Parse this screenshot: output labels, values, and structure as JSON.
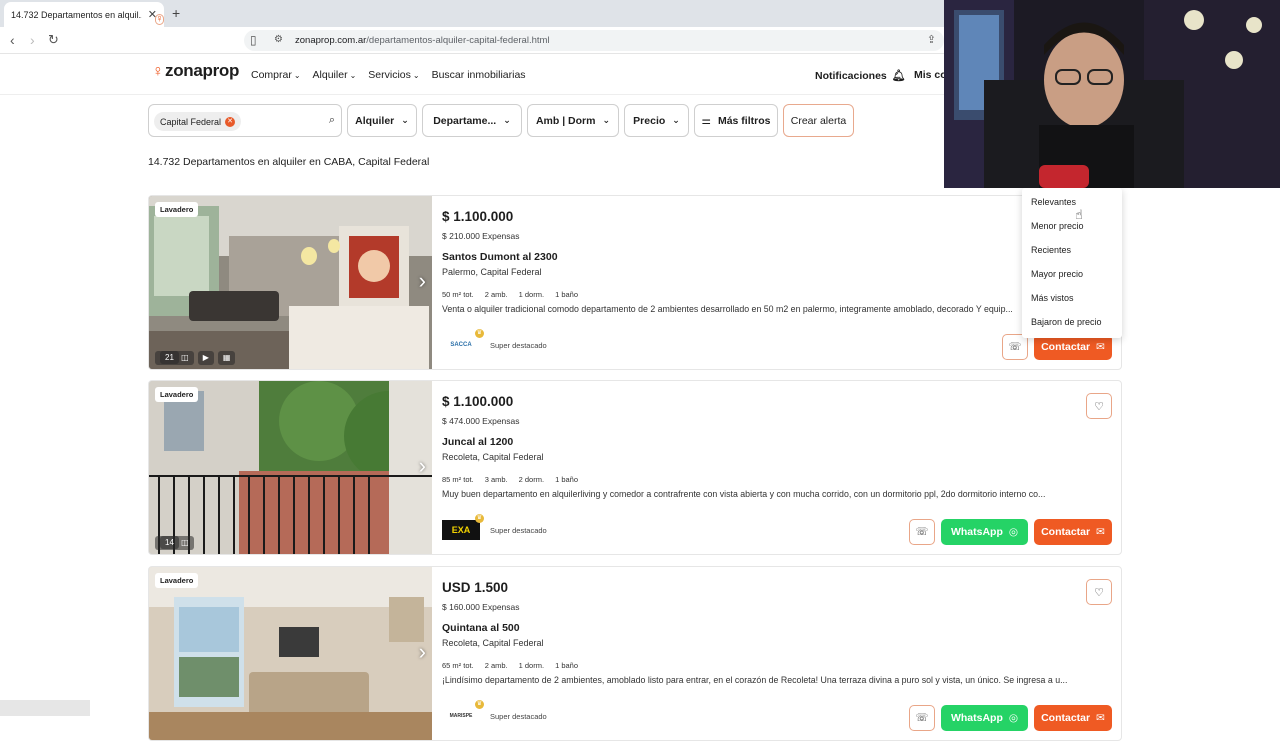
{
  "browser": {
    "tab_title": "14.732 Departamentos en alquil...",
    "url_domain": "zonaprop.com.ar",
    "url_path": "/departamentos-alquiler-capital-federal.html"
  },
  "header": {
    "logo_text": "zonaprop",
    "menu": [
      "Comprar",
      "Alquiler",
      "Servicios",
      "Buscar inmobiliarias"
    ],
    "notifications": "Notificaciones",
    "account_partial": "Mis co"
  },
  "filters": {
    "location_chip": "Capital Federal",
    "operation": "Alquiler",
    "property_type": "Departame...",
    "rooms": "Amb | Dorm",
    "price": "Precio",
    "more": "Más filtros",
    "create_alert": "Crear alerta"
  },
  "results_text": "14.732 Departamentos en alquiler en CABA, Capital Federal",
  "sort_options": [
    "Relevantes",
    "Menor precio",
    "Recientes",
    "Mayor precio",
    "Más vistos",
    "Bajaron de precio"
  ],
  "listings": [
    {
      "badge": "Lavadero",
      "price": "$ 1.100.000",
      "expenses": "$ 210.000 Expensas",
      "street": "Santos Dumont al 2300",
      "neighborhood": "Palermo, Capital Federal",
      "features": [
        "50 m² tot.",
        "2 amb.",
        "1 dorm.",
        "1 baño"
      ],
      "description": "Venta o alquiler tradicional comodo departamento de 2 ambientes desarrollado en 50 m2 en palermo, integramente amoblado, decorado Y equip...",
      "publisher": "SACCA",
      "tier": "Super destacado",
      "photo_count": "21",
      "contact": "Contactar"
    },
    {
      "badge": "Lavadero",
      "price": "$ 1.100.000",
      "expenses": "$ 474.000 Expensas",
      "street": "Juncal al 1200",
      "neighborhood": "Recoleta, Capital Federal",
      "features": [
        "85 m² tot.",
        "3 amb.",
        "2 dorm.",
        "1 baño"
      ],
      "description": "Muy buen departamento en alquilerliving y comedor a contrafrente con vista abierta y con mucha corrido, con un dormitorio ppl, 2do dormitorio interno co...",
      "publisher": "EXA",
      "tier": "Super destacado",
      "photo_count": "14",
      "whatsapp": "WhatsApp",
      "contact": "Contactar"
    },
    {
      "badge": "Lavadero",
      "price": "USD 1.500",
      "expenses": "$ 160.000 Expensas",
      "street": "Quintana al 500",
      "neighborhood": "Recoleta, Capital Federal",
      "features": [
        "65 m² tot.",
        "2 amb.",
        "1 dorm.",
        "1 baño"
      ],
      "description": "¡Lindísimo departamento de 2 ambientes, amoblado listo para entrar, en el corazón de Recoleta! Una terraza divina a puro sol y vista, un único. Se ingresa a u...",
      "publisher": "MARISPE",
      "tier": "Super destacado",
      "whatsapp": "WhatsApp",
      "contact": "Contactar"
    }
  ],
  "colors": {
    "brand": "#ef5a23",
    "whatsapp": "#25d366"
  }
}
